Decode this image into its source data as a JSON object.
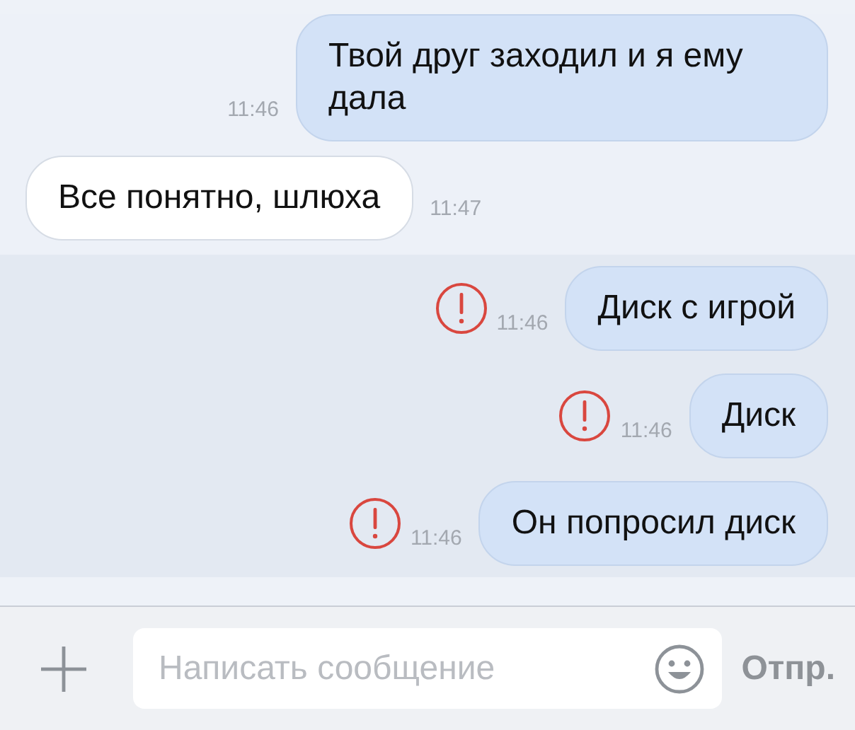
{
  "messages": [
    {
      "kind": "outgoing",
      "text": "Твой друг заходил и я ему дала",
      "time": "11:46",
      "failed": false
    },
    {
      "kind": "incoming",
      "text": "Все понятно, шлюха",
      "time": "11:47",
      "failed": false
    },
    {
      "kind": "outgoing",
      "text": "Диск с игрой",
      "time": "11:46",
      "failed": true
    },
    {
      "kind": "outgoing",
      "text": "Диск",
      "time": "11:46",
      "failed": true
    },
    {
      "kind": "outgoing",
      "text": "Он попросил диск",
      "time": "11:46",
      "failed": true
    }
  ],
  "composer": {
    "placeholder": "Написать сообщение",
    "send": "Отпр."
  }
}
